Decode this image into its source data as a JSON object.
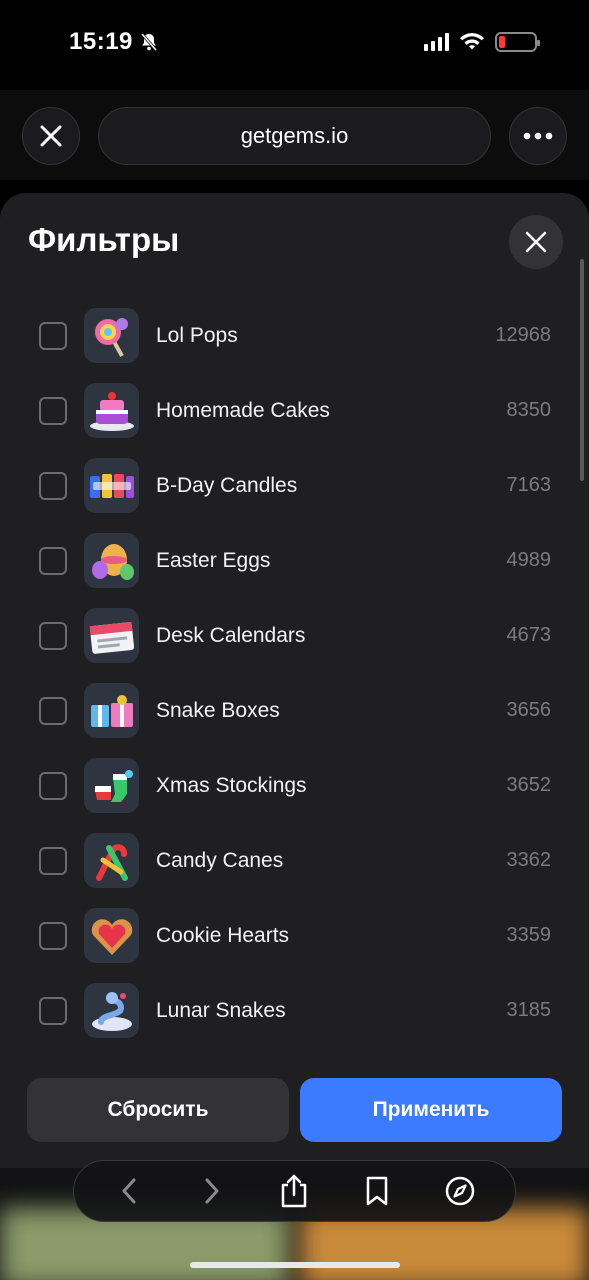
{
  "status": {
    "time": "15:19",
    "battery_color": "#ff3b30"
  },
  "browser": {
    "url": "getgems.io"
  },
  "sheet": {
    "title": "Фильтры",
    "items": [
      {
        "label": "Lol Pops",
        "count": "12968",
        "icon": "lollipop-icon"
      },
      {
        "label": "Homemade Cakes",
        "count": "8350",
        "icon": "cake-icon"
      },
      {
        "label": "B-Day Candles",
        "count": "7163",
        "icon": "candles-icon"
      },
      {
        "label": "Easter Eggs",
        "count": "4989",
        "icon": "easter-egg-icon"
      },
      {
        "label": "Desk Calendars",
        "count": "4673",
        "icon": "calendar-icon"
      },
      {
        "label": "Snake Boxes",
        "count": "3656",
        "icon": "gift-box-icon"
      },
      {
        "label": "Xmas Stockings",
        "count": "3652",
        "icon": "stocking-icon"
      },
      {
        "label": "Candy Canes",
        "count": "3362",
        "icon": "candy-cane-icon"
      },
      {
        "label": "Cookie Hearts",
        "count": "3359",
        "icon": "cookie-heart-icon"
      },
      {
        "label": "Lunar Snakes",
        "count": "3185",
        "icon": "snake-icon"
      }
    ],
    "reset_label": "Сбросить",
    "apply_label": "Применить",
    "apply_color": "#3b7bff"
  }
}
